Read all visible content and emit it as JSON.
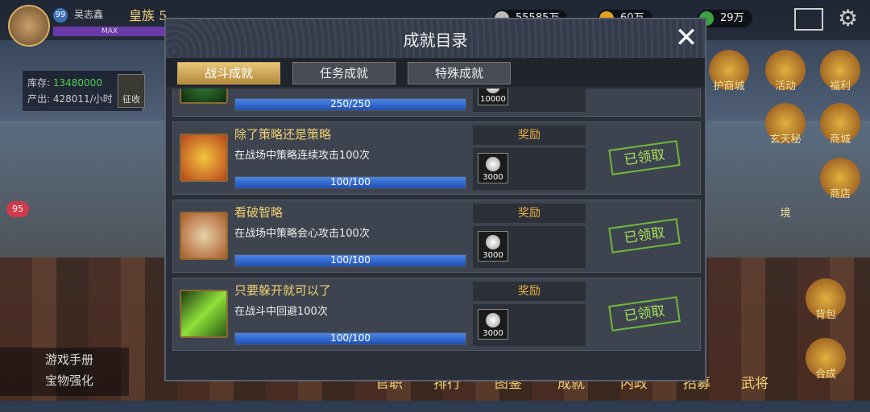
{
  "hud": {
    "player_level": "99",
    "player_name": "吴志鑫",
    "rank_label": "皇族",
    "rank_num": "5",
    "max_label": "MAX",
    "resource1": "55585万",
    "resource2": "60万",
    "resource3": "29万",
    "stock_label": "库存:",
    "stock_value": "13480000",
    "output_label": "产出:",
    "output_value": "428011/小时",
    "collect_label": "征收",
    "badge_count": "95",
    "left_menu": [
      "游戏手册",
      "宝物强化"
    ],
    "right_buttons": [
      "护商城",
      "活动",
      "福利",
      "玄天秘境",
      "商城",
      "商店",
      "背包",
      "合成"
    ],
    "bottom_buttons": [
      "官职",
      "排行",
      "图鉴",
      "成就",
      "内政",
      "招募",
      "武将"
    ]
  },
  "dialog": {
    "title": "成就目录",
    "tabs": [
      {
        "label": "战斗成就",
        "active": true
      },
      {
        "label": "任务成就",
        "active": false
      },
      {
        "label": "特殊成就",
        "active": false
      }
    ],
    "reward_label": "奖励",
    "claimed_label": "已领取",
    "items": [
      {
        "name": "",
        "desc": "",
        "progress": "250/250",
        "fill": 1.0,
        "reward": "10000",
        "icon": "achievement-icon"
      },
      {
        "name": "除了策略还是策略",
        "desc": "在战场中策略连续攻击100次",
        "progress": "100/100",
        "fill": 1.0,
        "reward": "3000",
        "icon": "strategy-icon"
      },
      {
        "name": "看破智略",
        "desc": "在战场中策略会心攻击100次",
        "progress": "100/100",
        "fill": 1.0,
        "reward": "3000",
        "icon": "sage-icon"
      },
      {
        "name": "只要躲开就可以了",
        "desc": "在战斗中回避100次",
        "progress": "100/100",
        "fill": 1.0,
        "reward": "3000",
        "icon": "dodge-icon"
      }
    ]
  }
}
